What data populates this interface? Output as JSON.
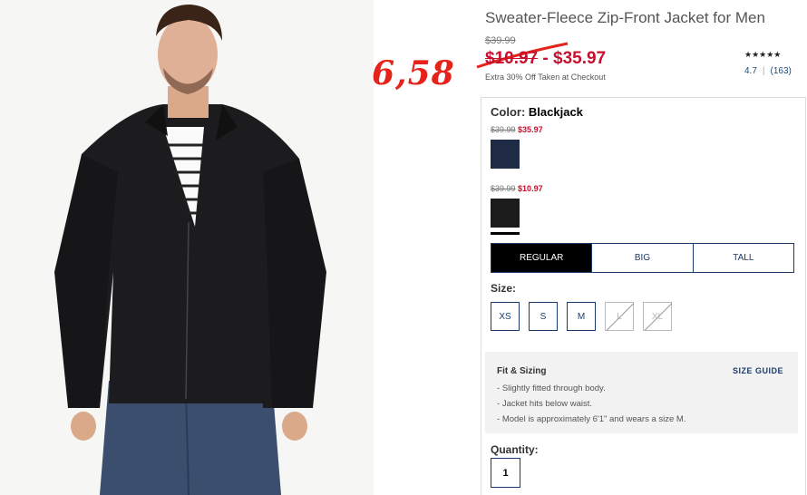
{
  "product": {
    "title": "Sweater-Fleece Zip-Front Jacket for Men",
    "original_price": "$39.99",
    "sale_low": "$10.97",
    "sale_dash": " - ",
    "sale_high": "$35.97",
    "promo": "Extra 30% Off Taken at Checkout",
    "stars": "★★★★★",
    "rating": "4.7",
    "review_count": "(163)"
  },
  "annotation": "6,58",
  "color": {
    "label": "Color:",
    "selected": "Blackjack",
    "swatches": [
      {
        "was": "$39.99",
        "now": "$35.97",
        "hex": "#1f2a44",
        "name": "navy"
      },
      {
        "was": "$39.99",
        "now": "$10.97",
        "hex": "#1b1b1b",
        "name": "black"
      }
    ]
  },
  "fit_tabs": [
    {
      "label": "REGULAR",
      "active": true
    },
    {
      "label": "BIG",
      "active": false
    },
    {
      "label": "TALL",
      "active": false
    }
  ],
  "size": {
    "label": "Size:",
    "options": [
      {
        "label": "XS",
        "available": true
      },
      {
        "label": "S",
        "available": true
      },
      {
        "label": "M",
        "available": true
      },
      {
        "label": "L",
        "available": false
      },
      {
        "label": "XL",
        "available": false
      }
    ]
  },
  "fit_sizing": {
    "title": "Fit & Sizing",
    "guide_link": "SIZE GUIDE",
    "bullets": [
      "Slightly fitted through body.",
      "Jacket hits below waist.",
      "Model is approximately 6'1\" and wears a size M."
    ]
  },
  "quantity": {
    "label": "Quantity:",
    "value": "1"
  },
  "colors": {
    "accent_red": "#c8102e",
    "navy": "#1a3c6c",
    "annotation_red": "#e5231b"
  }
}
